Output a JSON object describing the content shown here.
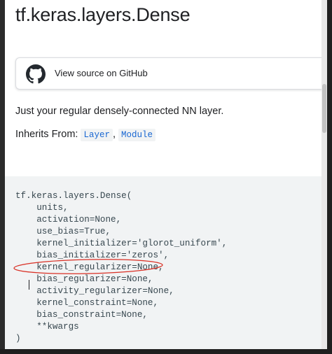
{
  "page": {
    "title": "tf.keras.layers.Dense",
    "github_button": {
      "label": "View source on GitHub",
      "icon": "github-icon"
    },
    "description": "Just your regular densely-connected NN layer.",
    "inherits": {
      "label": "Inherits From:",
      "separator": ",",
      "links": [
        "Layer",
        "Module"
      ]
    },
    "code": {
      "lines": [
        "tf.keras.layers.Dense(",
        "    units,",
        "    activation=None,",
        "    use_bias=True,",
        "    kernel_initializer='glorot_uniform',",
        "    bias_initializer='zeros',",
        "    kernel_regularizer=None,",
        "    bias_regularizer=None,",
        "    activity_regularizer=None,",
        "    kernel_constraint=None,",
        "    bias_constraint=None,",
        "    **kwargs",
        ")"
      ],
      "highlighted_line": "    kernel_regularizer=None,"
    }
  },
  "colors": {
    "link": "#1967d2",
    "code_background": "#f1f3f4",
    "annotation": "#d93025",
    "text": "#202124"
  }
}
